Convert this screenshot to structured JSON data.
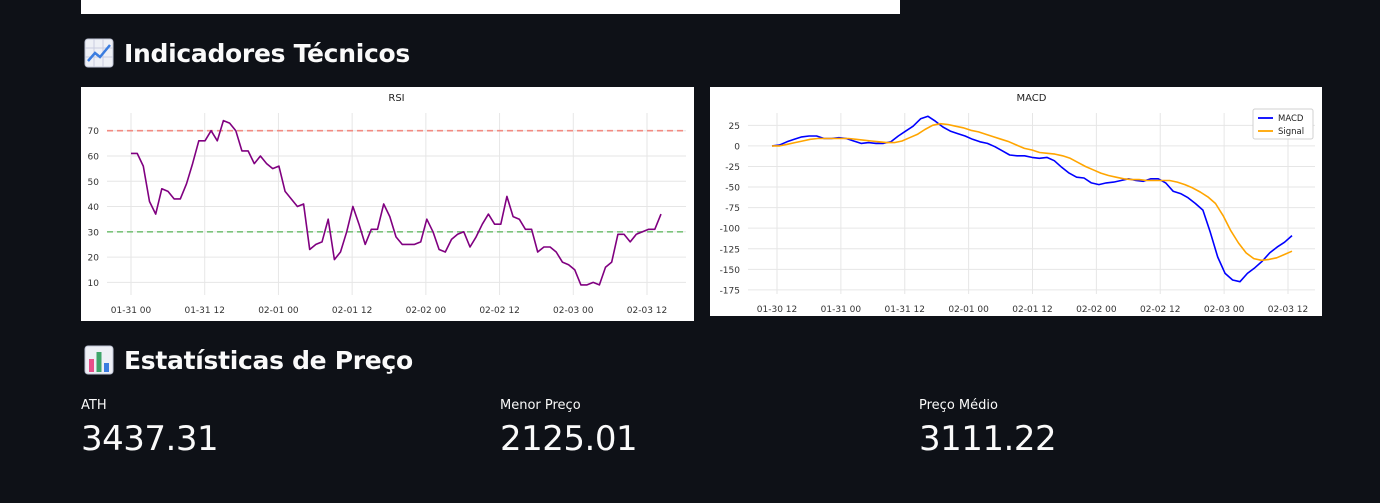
{
  "sections": {
    "indicators_title": "Indicadores Técnicos",
    "stats_title": "Estatísticas de Preço"
  },
  "metrics": [
    {
      "label": "ATH",
      "value": "3437.31"
    },
    {
      "label": "Menor Preço",
      "value": "2125.01"
    },
    {
      "label": "Preço Médio",
      "value": "3111.22"
    }
  ],
  "colors": {
    "rsi_line": "#800080",
    "overbought": "#f28b82",
    "oversold": "#7cc47c",
    "macd": "#0000ff",
    "signal": "#ffa500"
  },
  "chart_data": [
    {
      "type": "line",
      "title": "RSI",
      "xlabel": "",
      "ylabel": "",
      "x_tick_labels": [
        "01-31 00",
        "01-31 12",
        "02-01 00",
        "02-01 12",
        "02-02 00",
        "02-02 12",
        "02-03 00",
        "02-03 12"
      ],
      "y_ticks": [
        10,
        20,
        30,
        40,
        50,
        60,
        70
      ],
      "ylim": [
        5,
        77
      ],
      "grid": true,
      "reference_lines": [
        {
          "y": 70,
          "color": "red",
          "style": "dashed"
        },
        {
          "y": 30,
          "color": "green",
          "style": "dashed"
        }
      ],
      "series": [
        {
          "values": [
            61,
            61,
            56,
            42,
            37,
            47,
            46,
            43,
            43,
            49,
            57,
            66,
            66,
            70,
            66,
            74,
            73,
            70,
            62,
            62,
            57,
            60,
            57,
            55,
            56,
            46,
            43,
            40,
            41,
            23,
            25,
            26,
            35,
            19,
            22,
            30,
            40,
            33,
            25,
            31,
            31,
            41,
            36,
            28,
            25,
            25,
            25,
            26,
            35,
            30,
            23,
            22,
            27,
            29,
            30,
            24,
            28,
            33,
            37,
            33,
            33,
            44,
            36,
            35,
            31,
            31,
            22,
            24,
            24,
            22,
            18,
            17,
            15,
            9,
            9,
            10,
            9,
            16,
            18,
            29,
            29,
            26,
            29,
            30,
            31,
            31,
            37
          ]
        }
      ]
    },
    {
      "type": "line",
      "title": "MACD",
      "xlabel": "",
      "ylabel": "",
      "x_tick_labels": [
        "01-30 12",
        "01-31 00",
        "01-31 12",
        "02-01 00",
        "02-01 12",
        "02-02 00",
        "02-02 12",
        "02-03 00",
        "02-03 12"
      ],
      "y_ticks": [
        25,
        0,
        -25,
        -50,
        -75,
        -100,
        -125,
        -150,
        -175
      ],
      "ylim": [
        -180,
        40
      ],
      "grid": true,
      "legend_position": "top-right",
      "series": [
        {
          "name": "MACD",
          "values": [
            0,
            1,
            5,
            8,
            11,
            12,
            12,
            9,
            9,
            10,
            9,
            6,
            3,
            4,
            3,
            3,
            5,
            12,
            18,
            24,
            33,
            36,
            30,
            23,
            18,
            15,
            12,
            8,
            5,
            3,
            -1,
            -6,
            -11,
            -12,
            -12,
            -14,
            -15,
            -14,
            -18,
            -26,
            -33,
            -38,
            -39,
            -45,
            -47,
            -45,
            -44,
            -42,
            -40,
            -42,
            -43,
            -40,
            -40,
            -45,
            -55,
            -58,
            -63,
            -70,
            -78,
            -105,
            -135,
            -155,
            -163,
            -165,
            -155,
            -148,
            -140,
            -130,
            -123,
            -117,
            -109
          ]
        },
        {
          "name": "Signal",
          "values": [
            0,
            0,
            2,
            4,
            6,
            8,
            9,
            9,
            9,
            9,
            9,
            8,
            7,
            6,
            5,
            4,
            4,
            6,
            10,
            14,
            20,
            25,
            27,
            26,
            24,
            22,
            19,
            17,
            14,
            11,
            8,
            5,
            1,
            -3,
            -5,
            -8,
            -9,
            -10,
            -12,
            -15,
            -20,
            -25,
            -29,
            -33,
            -36,
            -38,
            -40,
            -41,
            -41,
            -42,
            -42,
            -42,
            -42,
            -44,
            -47,
            -51,
            -56,
            -62,
            -70,
            -85,
            -103,
            -118,
            -130,
            -137,
            -139,
            -138,
            -136,
            -132,
            -128
          ]
        }
      ]
    }
  ]
}
